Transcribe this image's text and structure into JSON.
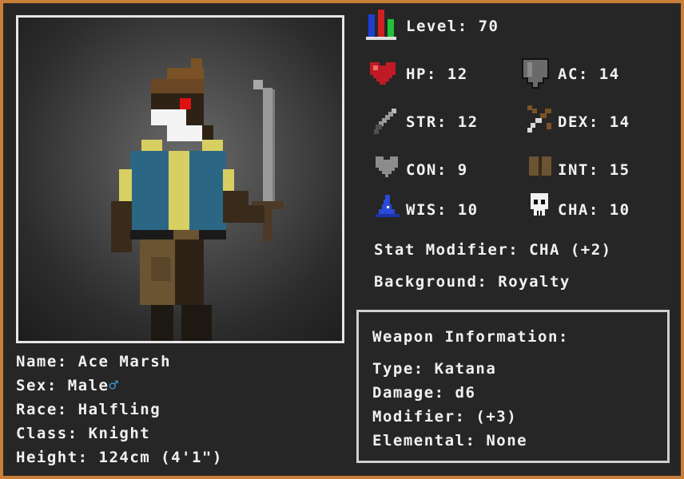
{
  "character": {
    "name": "Name: Ace Marsh",
    "sex": "Sex: Male",
    "sex_symbol": "♂",
    "race": "Race: Halfling",
    "class": "Class: Knight",
    "height": "Height: 124cm (4'1\")"
  },
  "stats": {
    "level": "Level: 70",
    "hp": "HP: 12",
    "ac": "AC: 14",
    "str": "STR: 12",
    "dex": "DEX: 14",
    "con": "CON: 9",
    "int": "INT: 15",
    "wis": "WIS: 10",
    "cha": "CHA: 10",
    "stat_modifier": "Stat Modifier: CHA (+2)",
    "background": "Background: Royalty"
  },
  "weapon": {
    "title": "Weapon Information:",
    "type": "Type: Katana",
    "damage": "Damage: d6",
    "modifier": "Modifier: (+3)",
    "elemental": "Elemental: None"
  },
  "colors": {
    "frame_border": "#c87f38",
    "panel_bg": "#262626",
    "text": "#f1f1f1",
    "male_symbol": "#3a9ae0"
  },
  "icons": [
    "level-bars-icon",
    "heart-icon",
    "shield-icon",
    "sword-icon",
    "bow-icon",
    "gray-heart-icon",
    "book-icon",
    "wizard-hat-icon",
    "skull-icon",
    "male-symbol-icon"
  ]
}
